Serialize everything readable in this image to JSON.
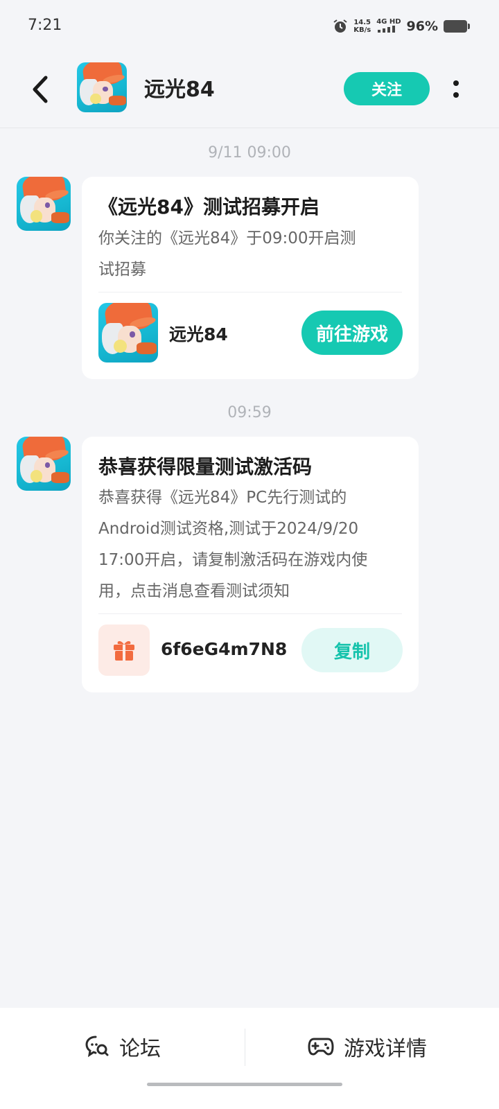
{
  "status_bar": {
    "time": "7:21",
    "net_speed_value": "14.5",
    "net_speed_unit": "KB/s",
    "signal_label": "4G HD",
    "battery_percent": "96%",
    "icons": [
      "alarm-icon",
      "signal-icon",
      "battery-icon"
    ]
  },
  "header": {
    "title": "远光84",
    "follow_label": "关注",
    "back_icon": "chevron-left-icon",
    "more_icon": "more-vertical-icon"
  },
  "messages": [
    {
      "time": "9/11  09:00",
      "title": "《远光84》测试招募开启",
      "body_lines": [
        "你关注的《远光84》于09:00开启测",
        "试招募"
      ],
      "game_name": "远光84",
      "action_label": "前往游戏"
    },
    {
      "time": "09:59",
      "title": "恭喜获得限量测试激活码",
      "body_lines": [
        "恭喜获得《远光84》PC先行测试的",
        "Android测试资格,测试于2024/9/20",
        "17:00开启，请复制激活码在游戏内使",
        "用，点击消息查看测试须知"
      ],
      "code": "6f6eG4m7N8",
      "copy_label": "复制",
      "gift_icon": "gift-icon"
    }
  ],
  "bottom_bar": {
    "forum_label": "论坛",
    "detail_label": "游戏详情",
    "forum_icon": "chat-search-icon",
    "detail_icon": "gamepad-icon"
  },
  "colors": {
    "accent": "#16c9b2",
    "background": "#f4f5f8",
    "gift_bg": "#fdebe6",
    "gift_icon": "#f26b3f"
  }
}
